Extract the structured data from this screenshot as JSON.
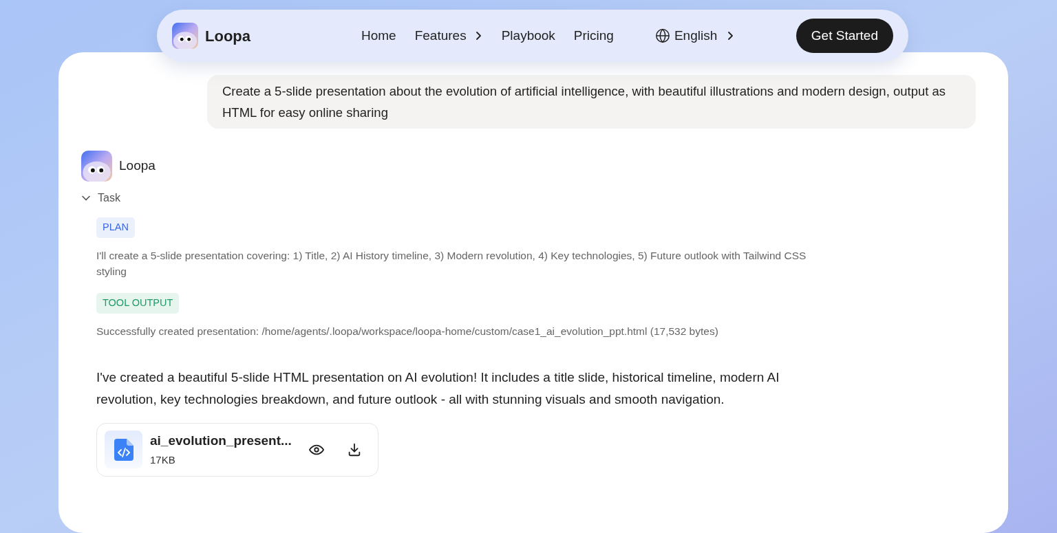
{
  "nav": {
    "brand": "Loopa",
    "links": [
      {
        "label": "Home",
        "has_submenu": false
      },
      {
        "label": "Features",
        "has_submenu": true
      },
      {
        "label": "Playbook",
        "has_submenu": false
      },
      {
        "label": "Pricing",
        "has_submenu": false
      }
    ],
    "language": "English",
    "cta": "Get Started"
  },
  "user_message": "Create a 5-slide presentation about the evolution of artificial intelligence, with beautiful illustrations and modern design, output as HTML for easy online sharing",
  "assistant": {
    "name": "Loopa",
    "task": {
      "label": "Task",
      "expanded": true,
      "steps": [
        {
          "kind": "plan",
          "badge": "PLAN",
          "text": "I'll create a 5-slide presentation covering: 1) Title, 2) AI History timeline, 3) Modern revolution, 4) Key technologies, 5) Future outlook with Tailwind CSS styling"
        },
        {
          "kind": "tool_output",
          "badge": "TOOL OUTPUT",
          "text": "Successfully created presentation: /home/agents/.loopa/workspace/loopa-home/custom/case1_ai_evolution_ppt.html (17,532 bytes)"
        }
      ]
    },
    "reply": "I've created a beautiful 5-slide HTML presentation on AI evolution! It includes a title slide, historical timeline, modern AI revolution, key technologies breakdown, and future outlook - all with stunning visuals and smooth navigation.",
    "file": {
      "name": "ai_evolution_present...",
      "size": "17KB"
    }
  }
}
